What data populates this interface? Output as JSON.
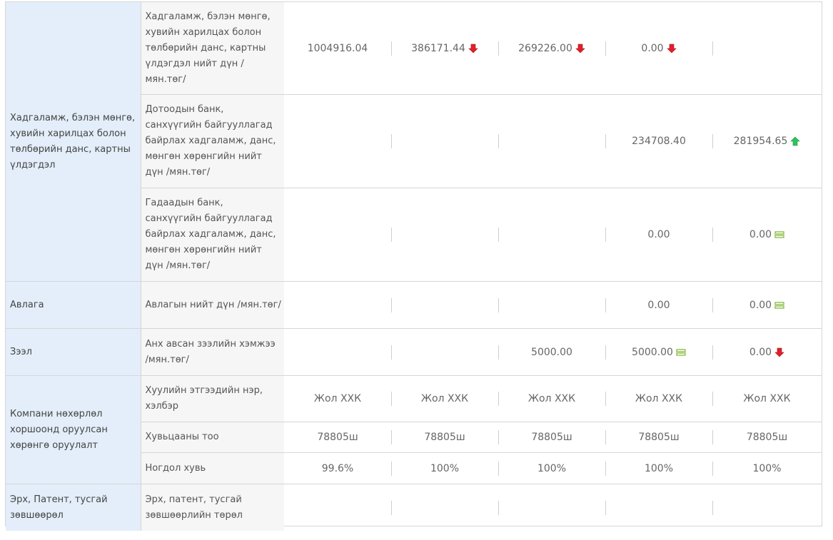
{
  "rows": [
    {
      "category": "",
      "label": "Хадгаламж, бэлэн мөнгө, хувийн харилцах болон төлбөрийн данс, картны үлдэгдэл нийт дүн /мян.төг/",
      "values": [
        {
          "text": "1004916.04",
          "icon": ""
        },
        {
          "text": "386171.44",
          "icon": "red-down-arrow-icon"
        },
        {
          "text": "269226.00",
          "icon": "red-down-arrow-icon"
        },
        {
          "text": "0.00",
          "icon": "red-down-arrow-icon"
        },
        {
          "text": "",
          "icon": ""
        }
      ]
    },
    {
      "category": "Хадгаламж, бэлэн мөнгө, хувийн харилцах болон төлбөрийн данс, картны үлдэгдэл",
      "label": "Дотоодын банк, санхүүгийн байгууллагад байрлах хадгаламж, данс, мөнгөн хөрөнгийн нийт дүн /мян.төг/",
      "values": [
        {
          "text": "",
          "icon": ""
        },
        {
          "text": "",
          "icon": ""
        },
        {
          "text": "",
          "icon": ""
        },
        {
          "text": "234708.40",
          "icon": ""
        },
        {
          "text": "281954.65",
          "icon": "green-up-arrow-icon"
        }
      ]
    },
    {
      "category": "",
      "label": "Гадаадын банк, санхүүгийн байгууллагад байрлах хадгаламж, данс, мөнгөн хөрөнгийн нийт дүн /мян.төг/",
      "values": [
        {
          "text": "",
          "icon": ""
        },
        {
          "text": "",
          "icon": ""
        },
        {
          "text": "",
          "icon": ""
        },
        {
          "text": "0.00",
          "icon": ""
        },
        {
          "text": "0.00",
          "icon": "equal-icon"
        }
      ]
    },
    {
      "category": "Авлага",
      "label": "Авлагын нийт дүн /мян.төг/",
      "values": [
        {
          "text": "",
          "icon": ""
        },
        {
          "text": "",
          "icon": ""
        },
        {
          "text": "",
          "icon": ""
        },
        {
          "text": "0.00",
          "icon": ""
        },
        {
          "text": "0.00",
          "icon": "equal-icon"
        }
      ]
    },
    {
      "category": "Зээл",
      "label": "Анх авсан зээлийн хэмжээ /мян.төг/",
      "values": [
        {
          "text": "",
          "icon": ""
        },
        {
          "text": "",
          "icon": ""
        },
        {
          "text": "5000.00",
          "icon": ""
        },
        {
          "text": "5000.00",
          "icon": "equal-icon"
        },
        {
          "text": "0.00",
          "icon": "red-down-arrow-icon"
        }
      ]
    },
    {
      "category": "Компани нөхөрлөл хоршоонд оруулсан хөрөнгө оруулалт",
      "label": "Хуулийн этгээдийн нэр, хэлбэр",
      "values": [
        {
          "text": "Жол ХХК",
          "icon": ""
        },
        {
          "text": "Жол ХХК",
          "icon": ""
        },
        {
          "text": "Жол ХХК",
          "icon": ""
        },
        {
          "text": "Жол ХХК",
          "icon": ""
        },
        {
          "text": "Жол ХХК",
          "icon": ""
        }
      ]
    },
    {
      "category": "",
      "label": "Хувьцааны тоо",
      "values": [
        {
          "text": "78805ш",
          "icon": ""
        },
        {
          "text": "78805ш",
          "icon": ""
        },
        {
          "text": "78805ш",
          "icon": ""
        },
        {
          "text": "78805ш",
          "icon": ""
        },
        {
          "text": "78805ш",
          "icon": ""
        }
      ]
    },
    {
      "category": "",
      "label": "Ногдол хувь",
      "values": [
        {
          "text": "99.6%",
          "icon": ""
        },
        {
          "text": "100%",
          "icon": ""
        },
        {
          "text": "100%",
          "icon": ""
        },
        {
          "text": "100%",
          "icon": ""
        },
        {
          "text": "100%",
          "icon": ""
        }
      ]
    },
    {
      "category": "Эрх, Патент, тусгай зөвшөөрөл",
      "label": "Эрх, патент, тусгай зөвшөөрлийн төрөл",
      "values": [
        {
          "text": "",
          "icon": ""
        },
        {
          "text": "",
          "icon": ""
        },
        {
          "text": "",
          "icon": ""
        },
        {
          "text": "",
          "icon": ""
        },
        {
          "text": "",
          "icon": ""
        }
      ]
    }
  ],
  "colors": {
    "red": "#e0202a",
    "green": "#2fc45a",
    "equal": "#8fbf4a"
  }
}
